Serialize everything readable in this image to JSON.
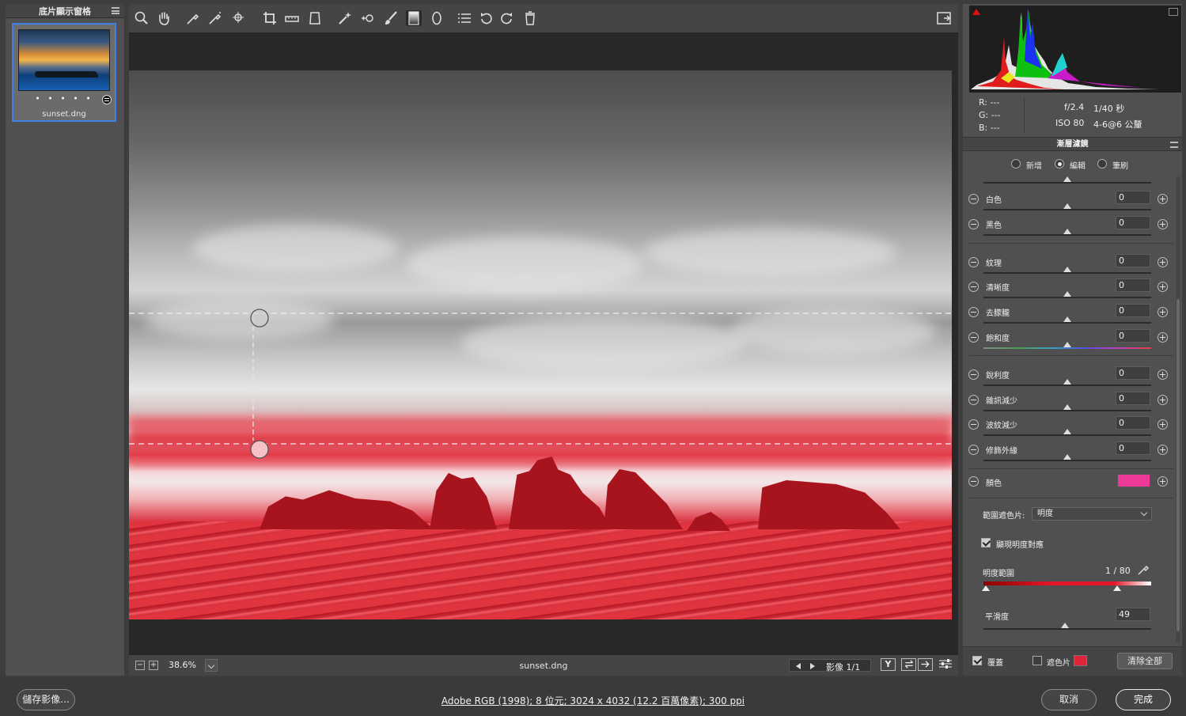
{
  "filmstrip": {
    "title": "底片顯示窗格",
    "thumbnail": {
      "filename": "sunset.dng",
      "rating": "• • • • •"
    }
  },
  "toolbar": {
    "tools": [
      "zoom-icon",
      "hand-icon",
      "white-balance-icon",
      "color-sampler-icon",
      "targeted-adjustment-icon",
      "crop-icon",
      "straighten-icon",
      "transform-icon",
      "spot-removal-icon",
      "red-eye-icon",
      "adjustment-brush-icon",
      "graduated-filter-icon",
      "radial-filter-icon",
      "preferences-icon",
      "rotate-left-icon",
      "rotate-right-icon",
      "trash-icon"
    ],
    "active_tool": "graduated-filter-icon"
  },
  "canvas": {
    "zoom": "38.6%",
    "filename": "sunset.dng",
    "image_count": "影像 1/1",
    "overlay_color": "#e02530",
    "view_buttons": [
      "Y",
      "",
      "",
      ""
    ]
  },
  "histogram": {
    "rgb": {
      "r": "R:  ---",
      "g": "G:  ---",
      "b": "B:  ---"
    },
    "exif": {
      "aperture": "f/2.4",
      "shutter": "1/40 秒",
      "iso": "ISO 80",
      "lens": "4-6@6 公釐"
    }
  },
  "filter_panel": {
    "title": "漸層濾鏡",
    "modes": [
      "新增",
      "編輯",
      "筆刷"
    ],
    "selected_mode": "編輯",
    "sliders": [
      {
        "label": "白色",
        "value": "0"
      },
      {
        "label": "黑色",
        "value": "0"
      },
      {
        "label": "紋理",
        "value": "0"
      },
      {
        "label": "清晰度",
        "value": "0"
      },
      {
        "label": "去朦朧",
        "value": "0"
      },
      {
        "label": "飽和度",
        "value": "0"
      },
      {
        "label": "銳利度",
        "value": "0"
      },
      {
        "label": "雜訊減少",
        "value": "0"
      },
      {
        "label": "波紋減少",
        "value": "0"
      },
      {
        "label": "修飾外緣",
        "value": "0"
      }
    ],
    "color_label": "顏色",
    "color_value": "#ee3a97",
    "range_mask_label": "範圍遮色片:",
    "range_mask_value": "明度",
    "show_luminance_label": "顯現明度對應",
    "luminance_range_label": "明度範圍",
    "luminance_range_value": "1 / 80",
    "smoothness_label": "平滑度",
    "smoothness_value": "49",
    "overlay_label": "覆蓋",
    "mask_label": "遮色片",
    "mask_color": "#e0253a",
    "clear_all": "清除全部"
  },
  "footer": {
    "save": "儲存影像...",
    "workflow": "Adobe RGB (1998); 8 位元; 3024 x 4032 (12.2 百萬像素); 300 ppi",
    "cancel": "取消",
    "done": "完成"
  }
}
